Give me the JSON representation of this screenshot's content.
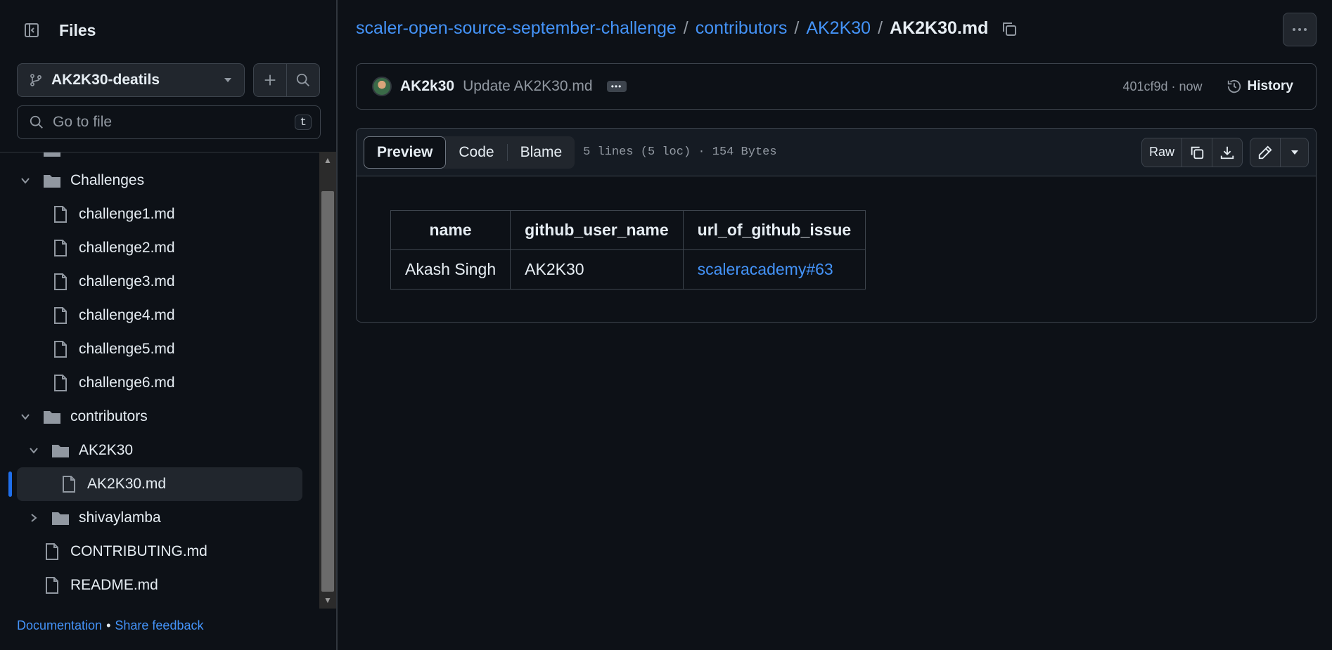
{
  "sidebar": {
    "title": "Files",
    "branch": "AK2K30-deatils",
    "goto_placeholder": "Go to file",
    "goto_shortcut": "t",
    "tree": [
      {
        "label": "Challenges"
      },
      {
        "label": "challenge1.md"
      },
      {
        "label": "challenge2.md"
      },
      {
        "label": "challenge3.md"
      },
      {
        "label": "challenge4.md"
      },
      {
        "label": "challenge5.md"
      },
      {
        "label": "challenge6.md"
      },
      {
        "label": "contributors"
      },
      {
        "label": "AK2K30"
      },
      {
        "label": "AK2K30.md"
      },
      {
        "label": "shivaylamba"
      },
      {
        "label": "CONTRIBUTING.md"
      },
      {
        "label": "README.md"
      }
    ],
    "footer": {
      "docs": "Documentation",
      "dot": "•",
      "feedback": "Share feedback"
    }
  },
  "breadcrumb": {
    "repo": "scaler-open-source-september-challenge",
    "sep": "/",
    "dir1": "contributors",
    "dir2": "AK2K30",
    "file": "AK2K30.md"
  },
  "commit": {
    "author": "AK2k30",
    "message": "Update AK2K30.md",
    "sha_time": "401cf9d · now",
    "history": "History"
  },
  "file": {
    "tabs": [
      "Preview",
      "Code",
      "Blame"
    ],
    "meta": "5 lines (5 loc) · 154 Bytes",
    "raw": "Raw",
    "table": {
      "headers": [
        "name",
        "github_user_name",
        "url_of_github_issue"
      ],
      "row": [
        "Akash Singh",
        "AK2K30",
        "scaleracademy#63"
      ]
    }
  }
}
